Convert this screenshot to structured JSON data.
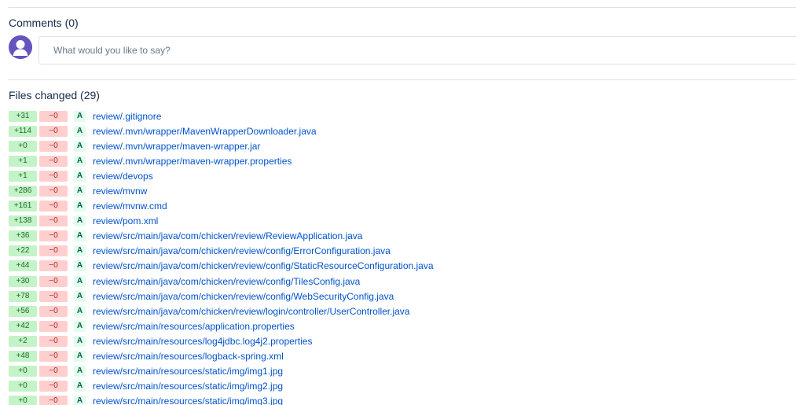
{
  "comments": {
    "title": "Comments (0)",
    "input_placeholder": "What would you like to say?"
  },
  "files_changed": {
    "title": "Files changed (29)",
    "files": [
      {
        "added": "+31",
        "removed": "−0",
        "status": "A",
        "path": "review/.gitignore"
      },
      {
        "added": "+114",
        "removed": "−0",
        "status": "A",
        "path": "review/.mvn/wrapper/MavenWrapperDownloader.java"
      },
      {
        "added": "+0",
        "removed": "−0",
        "status": "A",
        "path": "review/.mvn/wrapper/maven-wrapper.jar"
      },
      {
        "added": "+1",
        "removed": "−0",
        "status": "A",
        "path": "review/.mvn/wrapper/maven-wrapper.properties"
      },
      {
        "added": "+1",
        "removed": "−0",
        "status": "A",
        "path": "review/devops"
      },
      {
        "added": "+286",
        "removed": "−0",
        "status": "A",
        "path": "review/mvnw"
      },
      {
        "added": "+161",
        "removed": "−0",
        "status": "A",
        "path": "review/mvnw.cmd"
      },
      {
        "added": "+138",
        "removed": "−0",
        "status": "A",
        "path": "review/pom.xml"
      },
      {
        "added": "+36",
        "removed": "−0",
        "status": "A",
        "path": "review/src/main/java/com/chicken/review/ReviewApplication.java"
      },
      {
        "added": "+22",
        "removed": "−0",
        "status": "A",
        "path": "review/src/main/java/com/chicken/review/config/ErrorConfiguration.java"
      },
      {
        "added": "+44",
        "removed": "−0",
        "status": "A",
        "path": "review/src/main/java/com/chicken/review/config/StaticResourceConfiguration.java"
      },
      {
        "added": "+30",
        "removed": "−0",
        "status": "A",
        "path": "review/src/main/java/com/chicken/review/config/TilesConfig.java"
      },
      {
        "added": "+78",
        "removed": "−0",
        "status": "A",
        "path": "review/src/main/java/com/chicken/review/config/WebSecurityConfig.java"
      },
      {
        "added": "+56",
        "removed": "−0",
        "status": "A",
        "path": "review/src/main/java/com/chicken/review/login/controller/UserController.java"
      },
      {
        "added": "+42",
        "removed": "−0",
        "status": "A",
        "path": "review/src/main/resources/application.properties"
      },
      {
        "added": "+2",
        "removed": "−0",
        "status": "A",
        "path": "review/src/main/resources/log4jdbc.log4j2.properties"
      },
      {
        "added": "+48",
        "removed": "−0",
        "status": "A",
        "path": "review/src/main/resources/logback-spring.xml"
      },
      {
        "added": "+0",
        "removed": "−0",
        "status": "A",
        "path": "review/src/main/resources/static/img/img1.jpg"
      },
      {
        "added": "+0",
        "removed": "−0",
        "status": "A",
        "path": "review/src/main/resources/static/img/img2.jpg"
      },
      {
        "added": "+0",
        "removed": "−0",
        "status": "A",
        "path": "review/src/main/resources/static/img/img3.jpg"
      }
    ]
  },
  "colors": {
    "link": "#0052cc",
    "added_bg": "#c3f3c6",
    "removed_bg": "#ffcfcf",
    "status_bg": "#e3fcef",
    "avatar": "#6554c0"
  }
}
